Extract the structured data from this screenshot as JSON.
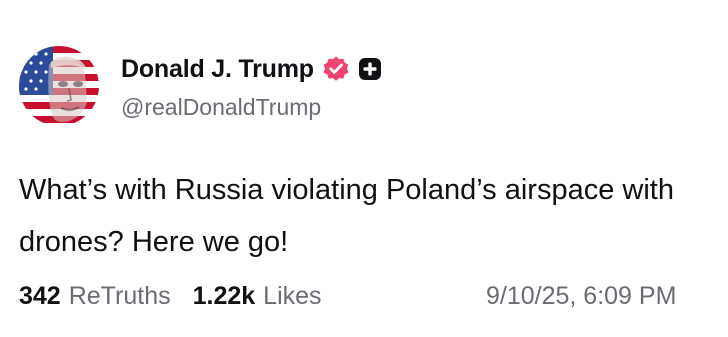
{
  "author": {
    "display_name": "Donald J. Trump",
    "handle": "@realDonaldTrump",
    "avatar_icon": "flag-portrait-avatar",
    "verified_icon": "verified-badge-icon",
    "extra_icon": "plus-badge-icon"
  },
  "post": {
    "text": "What’s with Russia violating Poland’s airspace with drones? Here we go!"
  },
  "stats": {
    "retruths_count": "342",
    "retruths_label": "ReTruths",
    "likes_count": "1.22k",
    "likes_label": "Likes"
  },
  "timestamp": "9/10/25, 6:09 PM",
  "colors": {
    "verified_badge": "#f0436e",
    "muted_text": "#6b6b75",
    "primary_text": "#111115",
    "flag_red": "#c8102e",
    "flag_blue": "#2a4a9a"
  }
}
